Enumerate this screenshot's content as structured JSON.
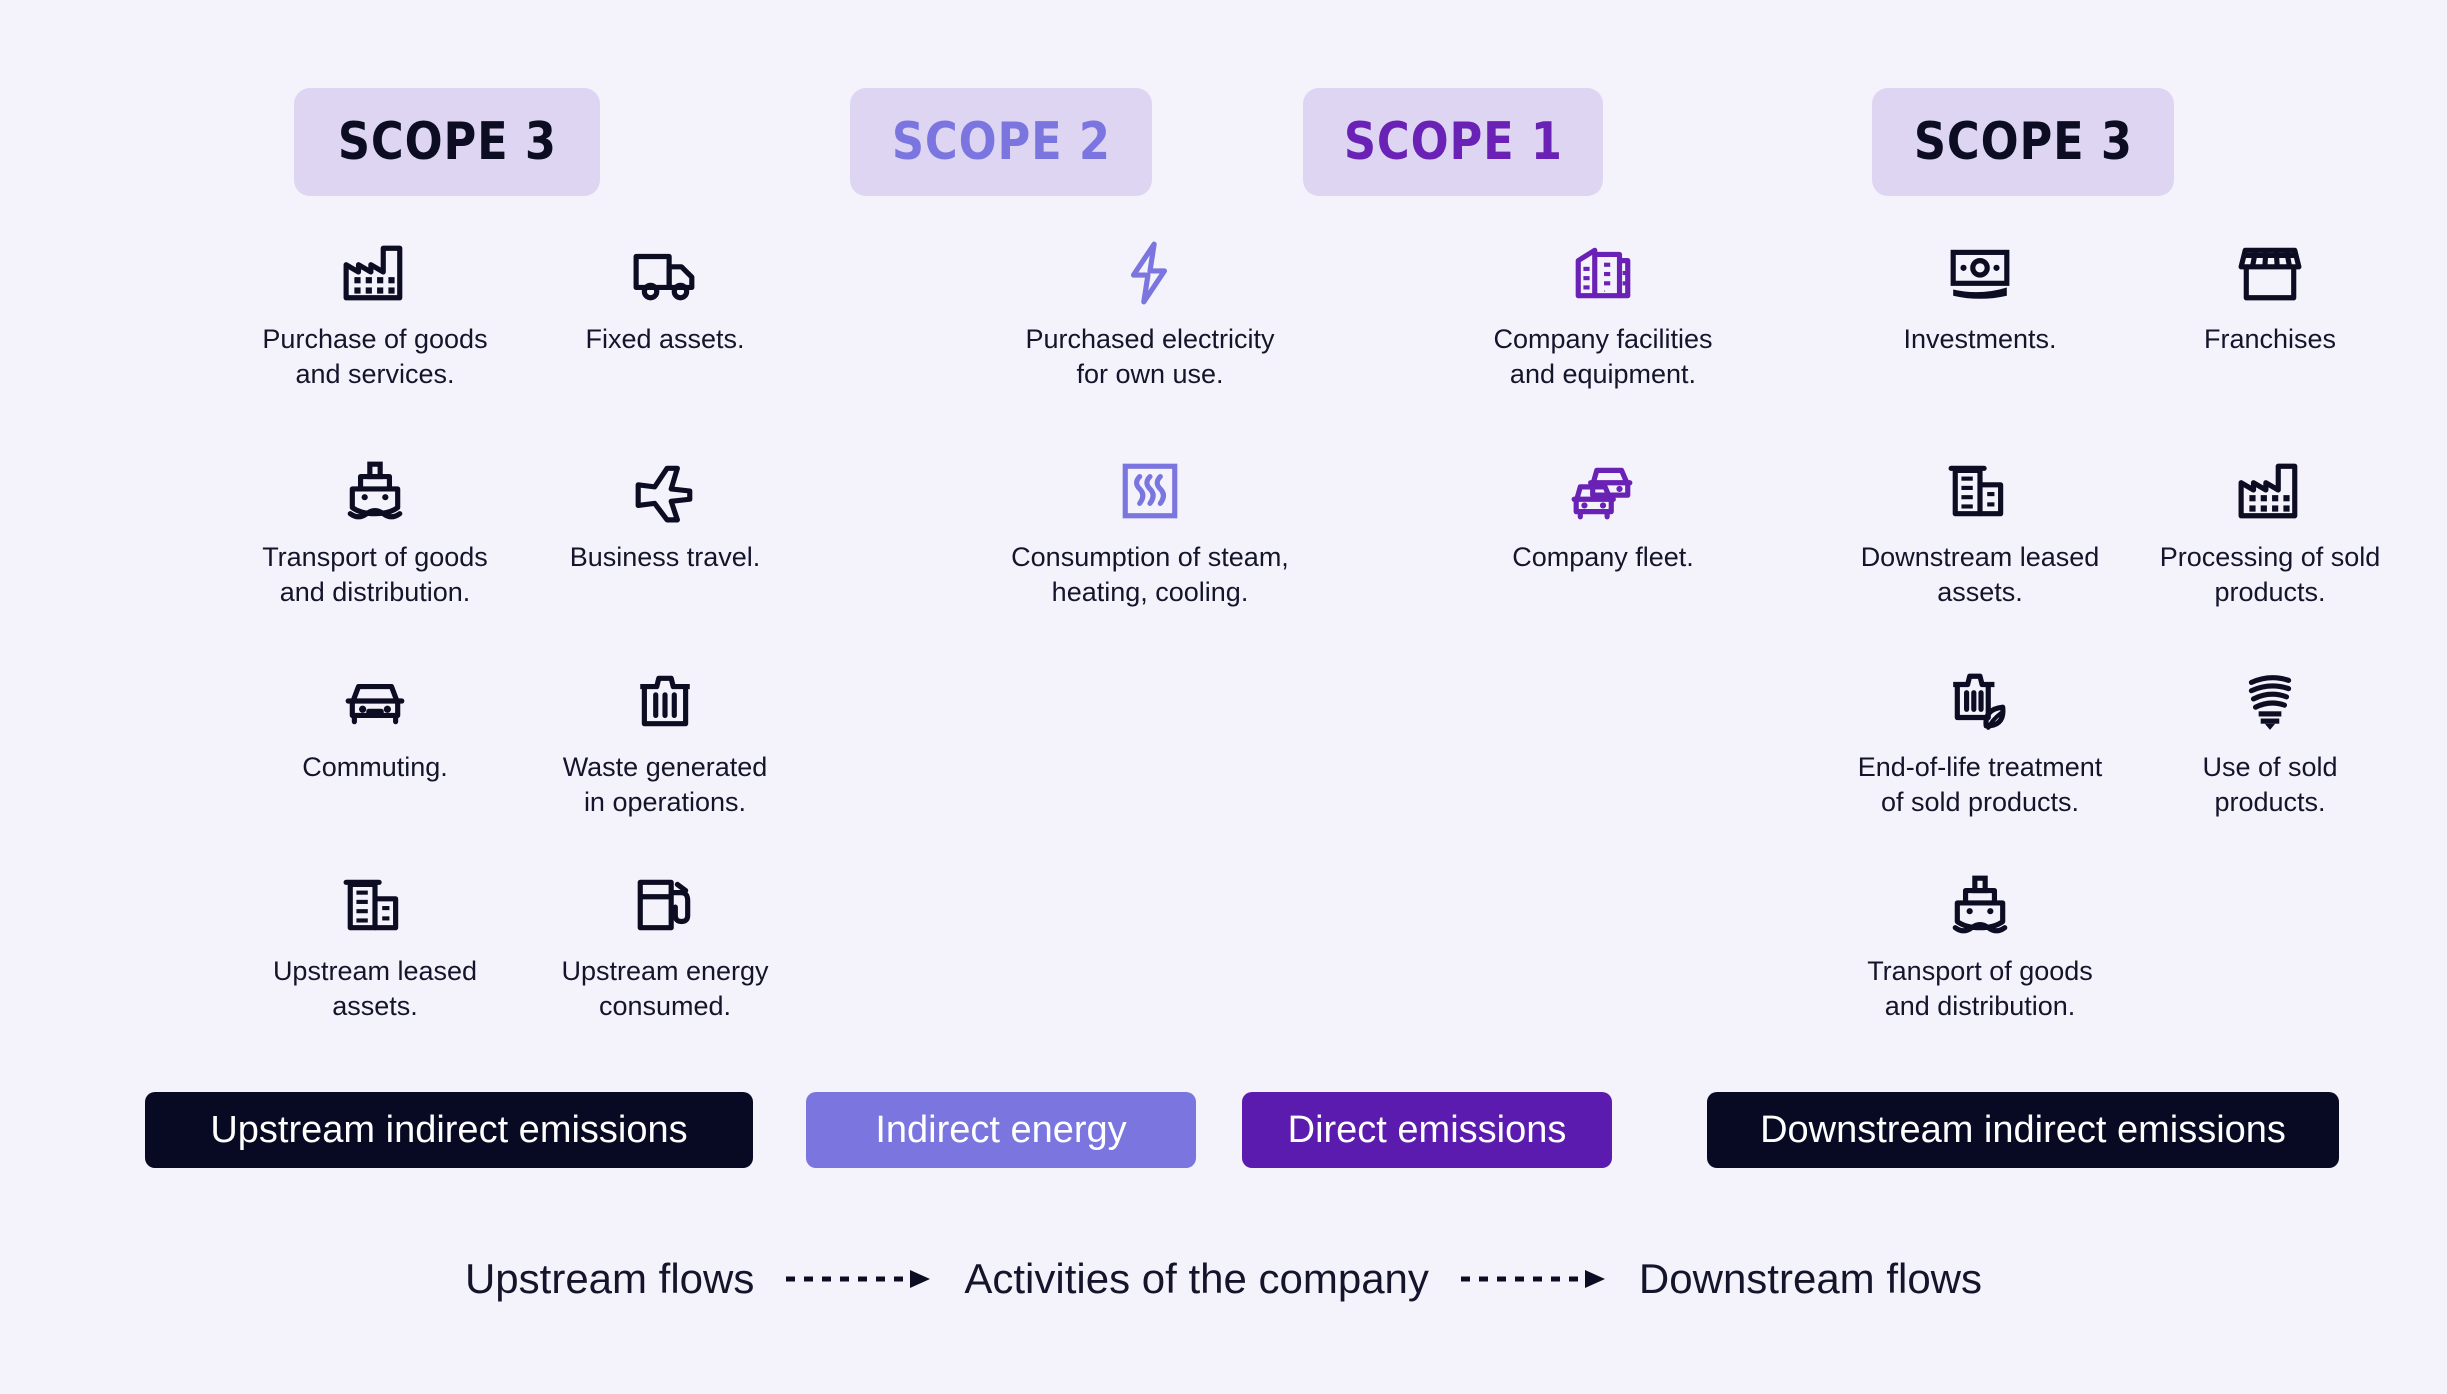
{
  "theme": {
    "background": "#f4f2fb",
    "chip_bg": "#ddd5f2",
    "ink": "#0c0d22",
    "scope3_color": "#0c0d22",
    "scope2_color": "#7b75e0",
    "scope1_color": "#6a21b5",
    "banner_dark": "#070a22",
    "banner_indigo": "#7b75e0",
    "banner_violet": "#5b1baf"
  },
  "chips": [
    {
      "label": "SCOPE 3",
      "color_key": "scope3_color"
    },
    {
      "label": "SCOPE 2",
      "color_key": "scope2_color"
    },
    {
      "label": "SCOPE 1",
      "color_key": "scope1_color"
    },
    {
      "label": "SCOPE 3",
      "color_key": "scope3_color"
    }
  ],
  "columns": [
    {
      "name": "upstream-scope3",
      "icon_color_key": "scope3_color",
      "subcolumns": [
        {
          "items": [
            {
              "icon": "factory-icon",
              "text": "Purchase of goods\nand services."
            },
            {
              "icon": "ship-icon",
              "text": "Transport of goods\nand distribution."
            },
            {
              "icon": "car-icon",
              "text": "Commuting."
            },
            {
              "icon": "buildings-icon",
              "text": "Upstream leased\nassets."
            }
          ]
        },
        {
          "items": [
            {
              "icon": "truck-icon",
              "text": "Fixed assets."
            },
            {
              "icon": "airplane-icon",
              "text": "Business travel."
            },
            {
              "icon": "trash-bin-icon",
              "text": "Waste generated\nin operations."
            },
            {
              "icon": "fuel-pump-icon",
              "text": "Upstream energy\nconsumed."
            }
          ]
        }
      ]
    },
    {
      "name": "scope2",
      "icon_color_key": "scope2_color",
      "subcolumns": [
        {
          "items": [
            {
              "icon": "lightning-bolt-icon",
              "text": "Purchased electricity\nfor own use."
            },
            {
              "icon": "radiator-heat-icon",
              "text": "Consumption of steam,\nheating, cooling."
            }
          ]
        }
      ]
    },
    {
      "name": "scope1",
      "icon_color_key": "scope1_color",
      "subcolumns": [
        {
          "items": [
            {
              "icon": "office-building-icon",
              "text": "Company facilities\nand equipment."
            },
            {
              "icon": "two-cars-fleet-icon",
              "text": "Company fleet."
            }
          ]
        }
      ]
    },
    {
      "name": "downstream-scope3",
      "icon_color_key": "scope3_color",
      "subcolumns": [
        {
          "items": [
            {
              "icon": "banknote-icon",
              "text": "Investments."
            },
            {
              "icon": "buildings-icon",
              "text": "Downstream leased\nassets."
            },
            {
              "icon": "trash-bin-leaf-icon",
              "text": "End-of-life treatment\nof sold products."
            },
            {
              "icon": "ship-icon",
              "text": "Transport of goods\nand distribution."
            }
          ]
        },
        {
          "items": [
            {
              "icon": "storefront-icon",
              "text": "Franchises"
            },
            {
              "icon": "factory-icon",
              "text": "Processing of sold\nproducts."
            },
            {
              "icon": "light-bulb-cfl-icon",
              "text": "Use of sold\nproducts."
            }
          ]
        }
      ]
    }
  ],
  "banners": [
    {
      "label": "Upstream indirect emissions",
      "color_key": "banner_dark"
    },
    {
      "label": "Indirect energy",
      "color_key": "banner_indigo"
    },
    {
      "label": "Direct emissions",
      "color_key": "banner_violet"
    },
    {
      "label": "Downstream indirect emissions",
      "color_key": "banner_dark"
    }
  ],
  "flows": {
    "items": [
      {
        "type": "label",
        "text": "Upstream flows"
      },
      {
        "type": "arrow",
        "name": "dashed-arrow-right-icon"
      },
      {
        "type": "label",
        "text": "Activities of the company"
      },
      {
        "type": "arrow",
        "name": "dashed-arrow-right-icon"
      },
      {
        "type": "label",
        "text": "Downstream flows"
      }
    ]
  }
}
